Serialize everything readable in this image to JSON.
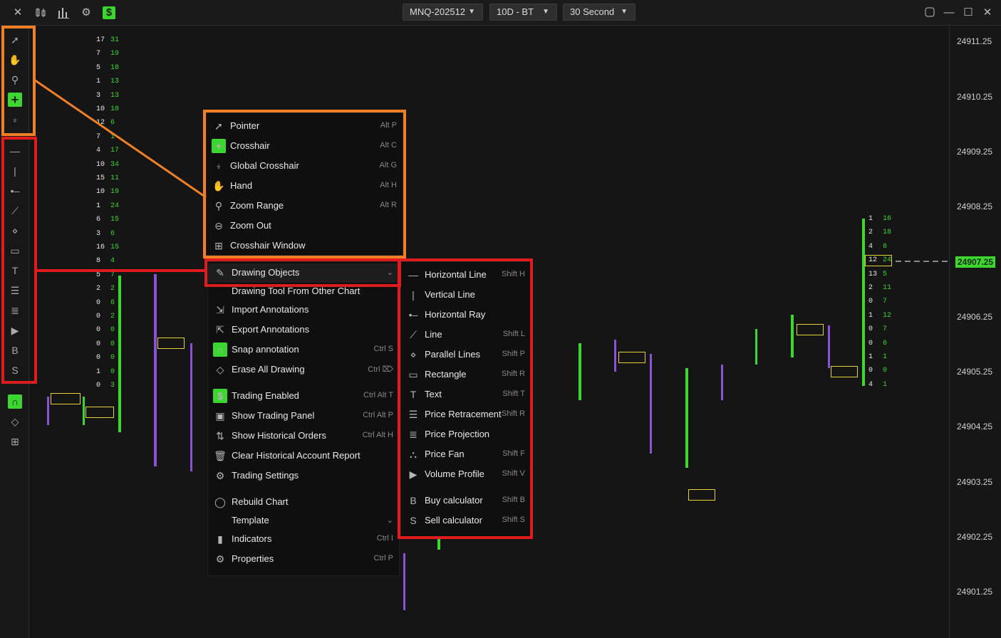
{
  "topbar": {
    "icons": [
      "close-icon",
      "candles-icon",
      "bars-icon",
      "gear-icon",
      "dollar-icon"
    ],
    "symbol": "MNQ-202512",
    "period": "10D - BT",
    "interval": "30 Second",
    "window_icons": [
      "restore-icon",
      "minimize-icon",
      "maximize-icon",
      "close-icon"
    ]
  },
  "price_axis": {
    "labels": [
      "24911.25",
      "24910.25",
      "24909.25",
      "24908.25",
      "24907.25",
      "24906.25",
      "24905.25",
      "24904.25",
      "24903.25",
      "24902.25",
      "24901.25"
    ],
    "current_price": "24907.25"
  },
  "pointer_menu": {
    "items": [
      {
        "label": "Pointer",
        "shortcut": "Alt P",
        "icon": "pointer-icon"
      },
      {
        "label": "Crosshair",
        "shortcut": "Alt C",
        "icon": "crosshair-icon"
      },
      {
        "label": "Global Crosshair",
        "shortcut": "Alt G",
        "icon": "global-crosshair-icon"
      },
      {
        "label": "Hand",
        "shortcut": "Alt H",
        "icon": "hand-icon"
      },
      {
        "label": "Zoom Range",
        "shortcut": "Alt R",
        "icon": "zoom-icon"
      },
      {
        "label": "Zoom Out",
        "shortcut": "",
        "icon": "zoom-out-icon"
      },
      {
        "label": "Crosshair Window",
        "shortcut": "",
        "icon": "crosshair-window-icon"
      }
    ]
  },
  "context_menu": {
    "drawing_objects": "Drawing Objects",
    "items": [
      {
        "label": "Drawing Tool From Other Chart",
        "shortcut": "",
        "icon": ""
      },
      {
        "label": "Import Annotations",
        "shortcut": "",
        "icon": "import-icon"
      },
      {
        "label": "Export Annotations",
        "shortcut": "",
        "icon": "export-icon"
      },
      {
        "label": "Snap annotation",
        "shortcut": "Ctrl S",
        "icon": "magnet-icon"
      },
      {
        "label": "Erase All Drawing",
        "shortcut": "Ctrl ⌦",
        "icon": "eraser-icon"
      },
      {
        "label": "Trading Enabled",
        "shortcut": "Ctrl Alt T",
        "icon": "dollar-icon"
      },
      {
        "label": "Show Trading Panel",
        "shortcut": "Ctrl Alt P",
        "icon": "panel-icon"
      },
      {
        "label": "Show Historical Orders",
        "shortcut": "Ctrl Alt H",
        "icon": "orders-icon"
      },
      {
        "label": "Clear Historical Account Report",
        "shortcut": "",
        "icon": "trash-icon"
      },
      {
        "label": "Trading Settings",
        "shortcut": "",
        "icon": "gear-icon"
      },
      {
        "label": "Rebuild Chart",
        "shortcut": "",
        "icon": "refresh-icon"
      },
      {
        "label": "Template",
        "shortcut": "",
        "icon": ""
      },
      {
        "label": "Indicators",
        "shortcut": "Ctrl I",
        "icon": "indicators-icon"
      },
      {
        "label": "Properties",
        "shortcut": "Ctrl P",
        "icon": "gear-icon"
      }
    ]
  },
  "drawing_submenu": {
    "items": [
      {
        "label": "Horizontal Line",
        "shortcut": "Shift H",
        "icon": "hline-icon"
      },
      {
        "label": "Vertical Line",
        "shortcut": "",
        "icon": "vline-icon"
      },
      {
        "label": "Horizontal Ray",
        "shortcut": "",
        "icon": "hray-icon"
      },
      {
        "label": "Line",
        "shortcut": "Shift L",
        "icon": "line-icon"
      },
      {
        "label": "Parallel Lines",
        "shortcut": "Shift P",
        "icon": "parallel-icon"
      },
      {
        "label": "Rectangle",
        "shortcut": "Shift R",
        "icon": "rectangle-icon"
      },
      {
        "label": "Text",
        "shortcut": "Shift T",
        "icon": "text-icon"
      },
      {
        "label": "Price Retracement",
        "shortcut": "Shift R",
        "icon": "retracement-icon"
      },
      {
        "label": "Price Projection",
        "shortcut": "",
        "icon": "projection-icon"
      },
      {
        "label": "Price Fan",
        "shortcut": "Shift F",
        "icon": "fan-icon"
      },
      {
        "label": "Volume Profile",
        "shortcut": "Shift V",
        "icon": "volume-profile-icon"
      },
      {
        "label": "Buy calculator",
        "shortcut": "Shift B",
        "icon": "buy-calc-icon"
      },
      {
        "label": "Sell calculator",
        "shortcut": "Shift S",
        "icon": "sell-calc-icon"
      }
    ]
  },
  "footprint": {
    "col1_left": [
      "17",
      "7",
      "5",
      "1",
      "3",
      "10",
      "12",
      "7",
      "4",
      "10",
      "15",
      "10",
      "1",
      "6",
      "3",
      "16",
      "8",
      "5",
      "2",
      "0",
      "0",
      "0",
      "0",
      "0",
      "1",
      "0"
    ],
    "col1_right": [
      "31",
      "19",
      "18",
      "13",
      "13",
      "18",
      "6",
      "1",
      "17",
      "34",
      "11",
      "19",
      "24",
      "15",
      "6",
      "15",
      "4",
      "7",
      "2",
      "6",
      "2",
      "0",
      "0",
      "0",
      "0",
      "3"
    ],
    "right_col_left": [
      "1",
      "2",
      "4",
      "12",
      "13",
      "2",
      "0",
      "1",
      "0",
      "0",
      "1",
      "0",
      "4"
    ],
    "right_col_right": [
      "16",
      "18",
      "6",
      "24",
      "5",
      "11",
      "7",
      "12",
      "7",
      "6",
      "1",
      "0",
      "1"
    ]
  }
}
